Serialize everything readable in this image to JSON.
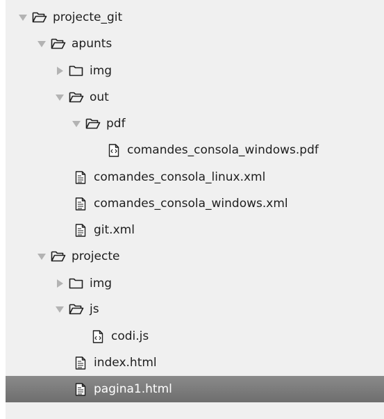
{
  "tree": {
    "root": {
      "label": "projecte_git"
    },
    "apunts": {
      "label": "apunts"
    },
    "apunts_img": {
      "label": "img"
    },
    "apunts_out": {
      "label": "out"
    },
    "apunts_out_pdf": {
      "label": "pdf"
    },
    "pdf_file": {
      "label": "comandes_consola_windows.pdf"
    },
    "xml_linux": {
      "label": "comandes_consola_linux.xml"
    },
    "xml_windows": {
      "label": "comandes_consola_windows.xml"
    },
    "xml_git": {
      "label": "git.xml"
    },
    "projecte": {
      "label": "projecte"
    },
    "projecte_img": {
      "label": "img"
    },
    "projecte_js": {
      "label": "js"
    },
    "codi_js": {
      "label": "codi.js"
    },
    "index_html": {
      "label": "index.html"
    },
    "pagina1_html": {
      "label": "pagina1.html",
      "selected": true
    }
  },
  "colors": {
    "panel_bg": "#f0f0f0",
    "selected_bg": "#7a7a7a",
    "arrow": "#b3b3b3",
    "text": "#1e1e1e"
  }
}
